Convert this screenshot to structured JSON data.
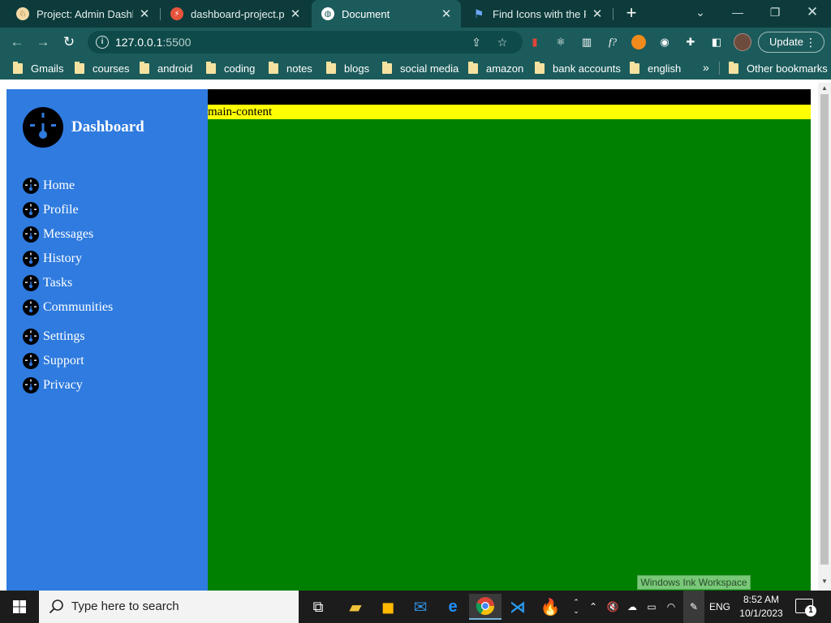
{
  "browser": {
    "tabs": [
      {
        "title": "Project: Admin Dashbo",
        "icon": "mascot-icon"
      },
      {
        "title": "dashboard-project.png",
        "icon": "lightning-icon"
      },
      {
        "title": "Document",
        "icon": "globe-icon",
        "active": true
      },
      {
        "title": "Find Icons with the Per",
        "icon": "flag-icon"
      }
    ],
    "url_host": "127.0.0.1",
    "url_port": ":5500",
    "update_label": "Update",
    "bookmarks": [
      "Gmails",
      "courses",
      "android",
      "coding",
      "notes",
      "blogs",
      "social media",
      "amazon",
      "bank accounts",
      "english"
    ],
    "more_bookmarks": "»",
    "other_bookmarks": "Other bookmarks"
  },
  "page": {
    "brand_title": "Dashboard",
    "nav_items": [
      "Home",
      "Profile",
      "Messages",
      "History",
      "Tasks",
      "Communities",
      "Settings",
      "Support",
      "Privacy"
    ],
    "main_label": "main-content",
    "colors": {
      "sidebar": "#2f7bdf",
      "topbar": "#000000",
      "main": "#008000",
      "label_bg": "#ffff00"
    }
  },
  "tooltip": "Windows Ink Workspace",
  "taskbar": {
    "search_placeholder": "Type here to search",
    "language": "ENG",
    "time": "8:52 AM",
    "date": "10/1/2023",
    "notification_count": "1"
  }
}
